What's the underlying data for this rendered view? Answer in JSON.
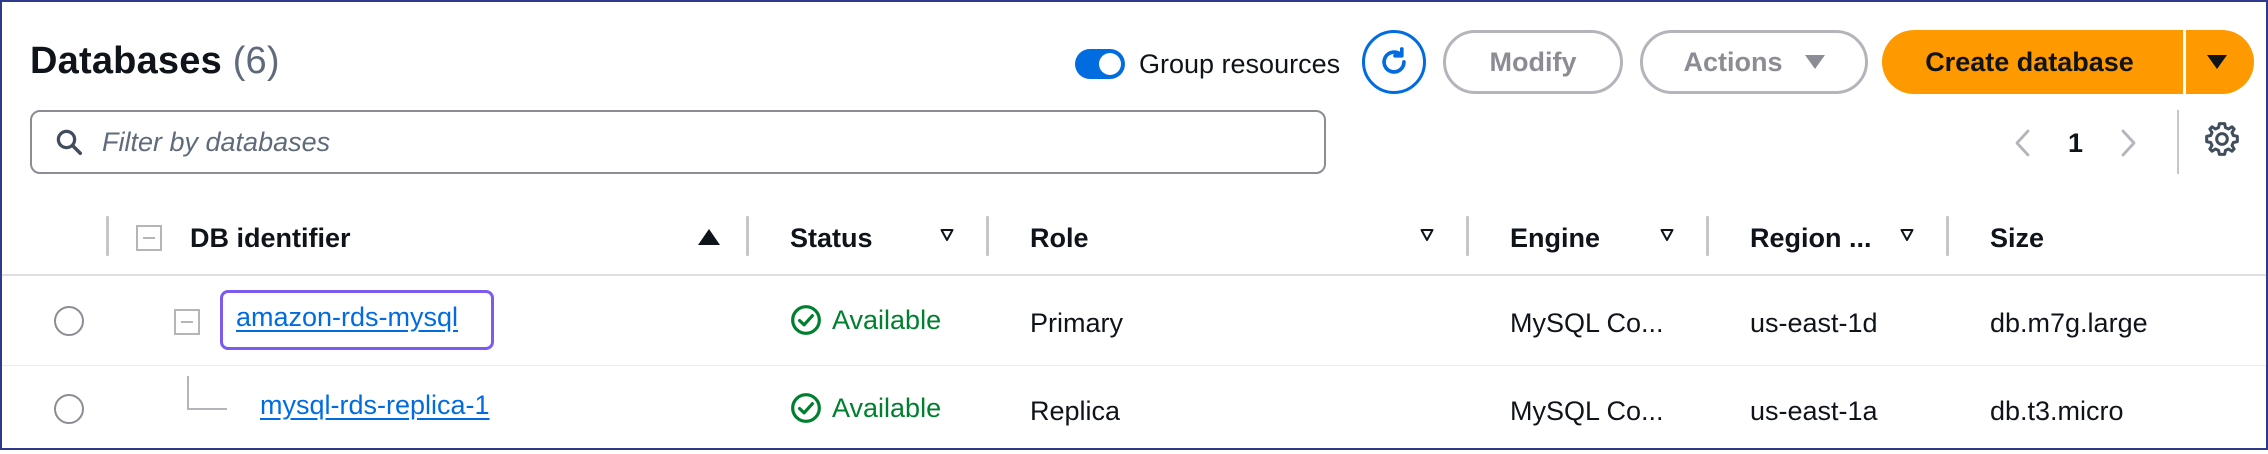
{
  "header": {
    "title": "Databases",
    "count": "(6)",
    "group_toggle_label": "Group resources",
    "group_toggle_on": true,
    "modify_label": "Modify",
    "actions_label": "Actions",
    "create_label": "Create database"
  },
  "filter": {
    "placeholder": "Filter by databases"
  },
  "pagination": {
    "current_page": "1"
  },
  "table": {
    "columns": [
      "DB identifier",
      "Status",
      "Role",
      "Engine",
      "Region ...",
      "Size"
    ],
    "rows": [
      {
        "identifier": "amazon-rds-mysql",
        "status": "Available",
        "role": "Primary",
        "engine": "MySQL Co...",
        "region": "us-east-1d",
        "size": "db.m7g.large"
      },
      {
        "identifier": "mysql-rds-replica-1",
        "status": "Available",
        "role": "Replica",
        "engine": "MySQL Co...",
        "region": "us-east-1a",
        "size": "db.t3.micro"
      }
    ]
  },
  "colors": {
    "primary_blue": "#006ce0",
    "create_orange": "#ff9900",
    "available_green": "#00802f",
    "focus_purple": "#7c5cf0"
  },
  "icons": [
    "refresh-icon",
    "search-icon",
    "chevron-left-icon",
    "chevron-right-icon",
    "settings-icon",
    "check-circle-icon",
    "sort-ascending-icon",
    "sort-descending-icon",
    "caret-down-icon"
  ]
}
